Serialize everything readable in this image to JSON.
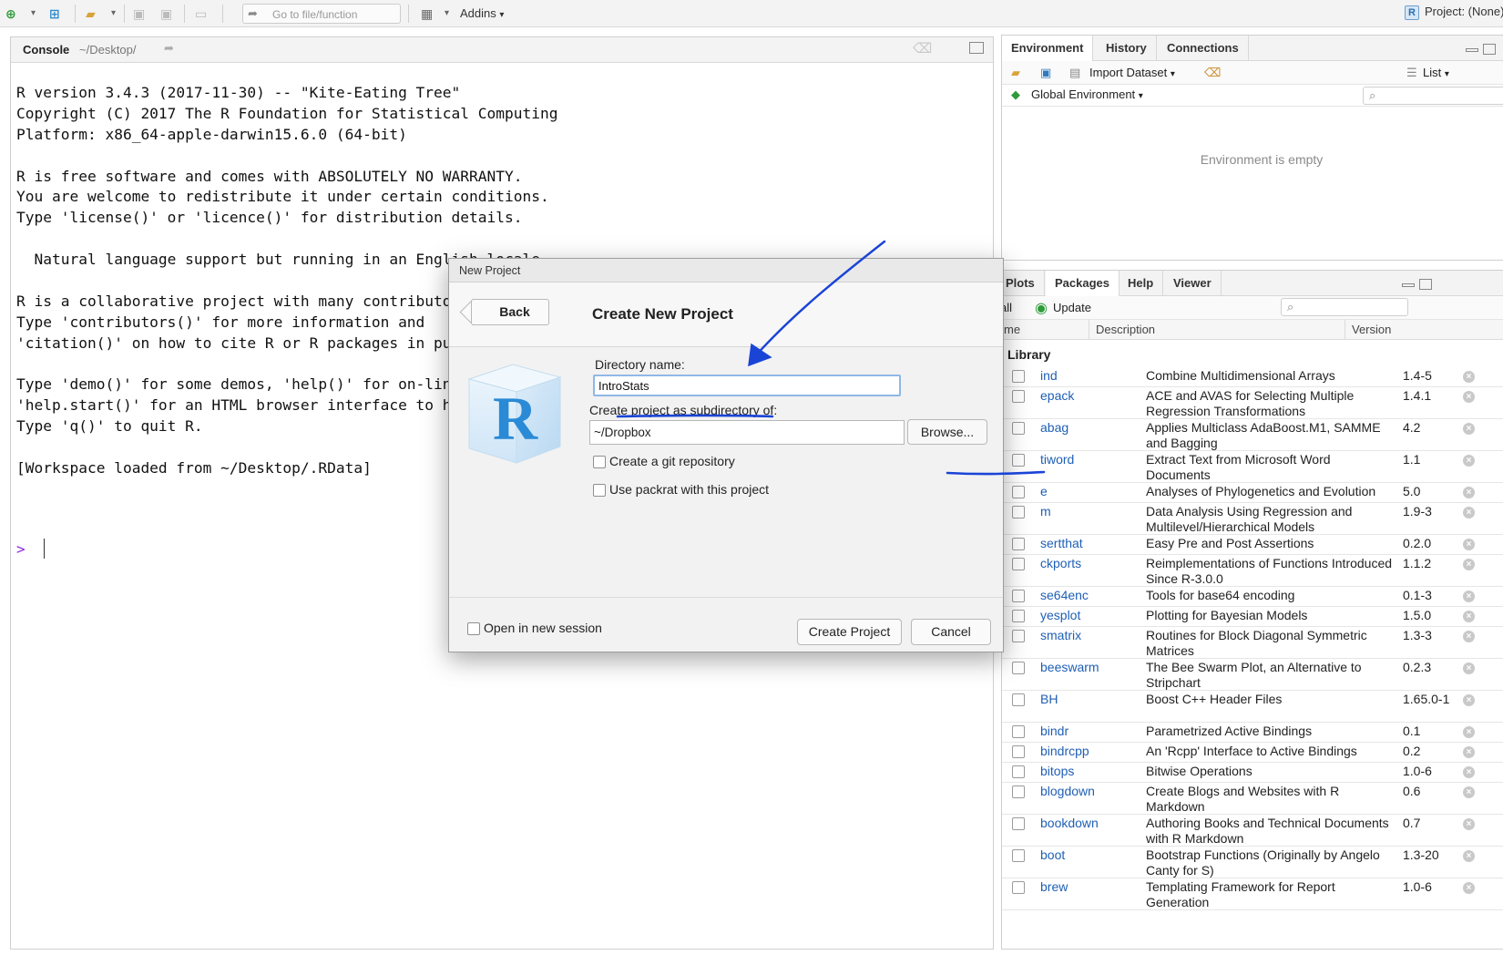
{
  "toolbar": {
    "goto_placeholder": "Go to file/function",
    "addins_label": "Addins",
    "project_label": "Project: (None)",
    "project_icon_letter": "R"
  },
  "console": {
    "title": "Console",
    "path": "~/Desktop/",
    "lines": [
      "R version 3.4.3 (2017-11-30) -- \"Kite-Eating Tree\"",
      "Copyright (C) 2017 The R Foundation for Statistical Computing",
      "Platform: x86_64-apple-darwin15.6.0 (64-bit)",
      "",
      "R is free software and comes with ABSOLUTELY NO WARRANTY.",
      "You are welcome to redistribute it under certain conditions.",
      "Type 'license()' or 'licence()' for distribution details.",
      "",
      "  Natural language support but running in an English locale",
      "",
      "R is a collaborative project with many contributors.",
      "Type 'contributors()' for more information and",
      "'citation()' on how to cite R or R packages in publi",
      "",
      "Type 'demo()' for some demos, 'help()' for on-line h",
      "'help.start()' for an HTML browser interface to help",
      "Type 'q()' to quit R.",
      "",
      "[Workspace loaded from ~/Desktop/.RData]"
    ],
    "prompt": ">"
  },
  "environment_pane": {
    "tabs": [
      {
        "label": "Environment",
        "active": true
      },
      {
        "label": "History",
        "active": false
      },
      {
        "label": "Connections",
        "active": false
      }
    ],
    "import_dataset_label": "Import Dataset",
    "list_label": "List",
    "scope_label": "Global Environment",
    "empty_message": "Environment is empty"
  },
  "packages_pane": {
    "tabs": [
      {
        "label": "Plots",
        "active": false
      },
      {
        "label": "Packages",
        "active": true
      },
      {
        "label": "Help",
        "active": false
      },
      {
        "label": "Viewer",
        "active": false
      }
    ],
    "install_label": "all",
    "update_label": "Update",
    "columns": {
      "name": "me",
      "description": "Description",
      "version": "Version"
    },
    "section_label": "Library",
    "packages": [
      {
        "name": "ind",
        "description": "Combine Multidimensional Arrays",
        "version": "1.4-5"
      },
      {
        "name": "epack",
        "description": "ACE and AVAS for Selecting Multiple Regression Transformations",
        "version": "1.4.1"
      },
      {
        "name": "abag",
        "description": "Applies Multiclass AdaBoost.M1, SAMME and Bagging",
        "version": "4.2"
      },
      {
        "name": "tiword",
        "description": "Extract Text from Microsoft Word Documents",
        "version": "1.1"
      },
      {
        "name": "e",
        "description": "Analyses of Phylogenetics and Evolution",
        "version": "5.0"
      },
      {
        "name": "m",
        "description": "Data Analysis Using Regression and Multilevel/Hierarchical Models",
        "version": "1.9-3"
      },
      {
        "name": "sertthat",
        "description": "Easy Pre and Post Assertions",
        "version": "0.2.0"
      },
      {
        "name": "ckports",
        "description": "Reimplementations of Functions Introduced Since R-3.0.0",
        "version": "1.1.2"
      },
      {
        "name": "se64enc",
        "description": "Tools for base64 encoding",
        "version": "0.1-3"
      },
      {
        "name": "yesplot",
        "description": "Plotting for Bayesian Models",
        "version": "1.5.0"
      },
      {
        "name": "smatrix",
        "description": "Routines for Block Diagonal Symmetric Matrices",
        "version": "1.3-3"
      },
      {
        "name": "beeswarm",
        "description": "The Bee Swarm Plot, an Alternative to Stripchart",
        "version": "0.2.3"
      },
      {
        "name": "BH",
        "description": "Boost C++ Header Files",
        "version": "1.65.0-1"
      },
      {
        "name": "bindr",
        "description": "Parametrized Active Bindings",
        "version": "0.1"
      },
      {
        "name": "bindrcpp",
        "description": "An 'Rcpp' Interface to Active Bindings",
        "version": "0.2"
      },
      {
        "name": "bitops",
        "description": "Bitwise Operations",
        "version": "1.0-6"
      },
      {
        "name": "blogdown",
        "description": "Create Blogs and Websites with R Markdown",
        "version": "0.6"
      },
      {
        "name": "bookdown",
        "description": "Authoring Books and Technical Documents with R Markdown",
        "version": "0.7"
      },
      {
        "name": "boot",
        "description": "Bootstrap Functions (Originally by Angelo Canty for S)",
        "version": "1.3-20"
      },
      {
        "name": "brew",
        "description": "Templating Framework for Report Generation",
        "version": "1.0-6"
      }
    ]
  },
  "dialog": {
    "window_title": "New Project",
    "back_label": "Back",
    "heading": "Create New Project",
    "directory_name_label": "Directory name:",
    "directory_name_value": "IntroStats",
    "subdir_label": "Create project as subdirectory of:",
    "subdir_value": "~/Dropbox",
    "browse_label": "Browse...",
    "git_label": "Create a git repository",
    "git_checked": false,
    "packrat_label": "Use packrat with this project",
    "packrat_checked": false,
    "open_session_label": "Open in new session",
    "open_session_checked": false,
    "create_label": "Create Project",
    "cancel_label": "Cancel",
    "logo_letter": "R"
  },
  "colors": {
    "annotation_blue": "#1a44d6",
    "link_blue": "#1f5fb5",
    "update_green": "#2e9b3a"
  }
}
